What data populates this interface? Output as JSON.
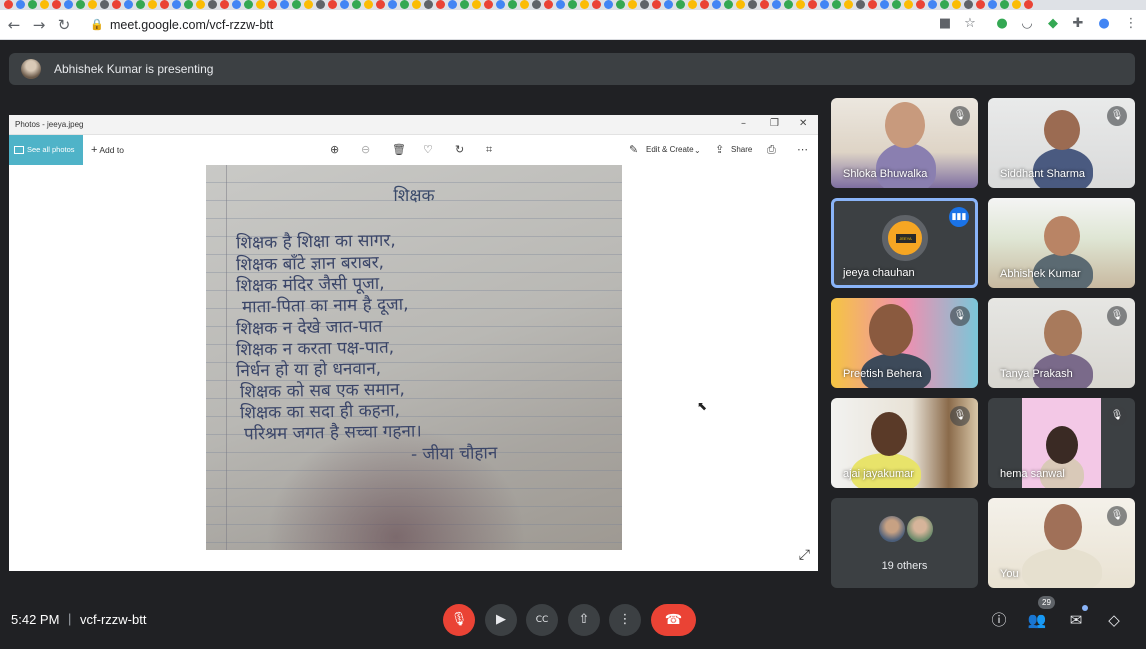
{
  "browser": {
    "url": "meet.google.com/vcf-rzzw-btt",
    "tab_colors": [
      "#ea4335",
      "#4285f4",
      "#34a853",
      "#fbbc05",
      "#ea4335",
      "#4285f4",
      "#34a853",
      "#fbbc05",
      "#5f6368",
      "#ea4335",
      "#4285f4",
      "#34a853",
      "#fbbc05",
      "#ea4335",
      "#4285f4",
      "#34a853",
      "#fbbc05",
      "#5f6368",
      "#ea4335",
      "#4285f4",
      "#34a853",
      "#fbbc05",
      "#ea4335",
      "#4285f4",
      "#34a853",
      "#fbbc05",
      "#5f6368",
      "#ea4335",
      "#4285f4",
      "#34a853",
      "#fbbc05",
      "#ea4335",
      "#4285f4",
      "#34a853",
      "#fbbc05",
      "#5f6368",
      "#ea4335",
      "#4285f4",
      "#34a853",
      "#fbbc05",
      "#ea4335",
      "#4285f4",
      "#34a853",
      "#fbbc05",
      "#5f6368",
      "#ea4335",
      "#4285f4",
      "#34a853",
      "#fbbc05",
      "#ea4335",
      "#4285f4",
      "#34a853",
      "#fbbc05",
      "#5f6368",
      "#ea4335",
      "#4285f4",
      "#34a853",
      "#fbbc05",
      "#ea4335",
      "#4285f4",
      "#34a853",
      "#fbbc05",
      "#5f6368",
      "#ea4335",
      "#4285f4",
      "#34a853",
      "#fbbc05",
      "#ea4335",
      "#4285f4",
      "#34a853",
      "#fbbc05",
      "#5f6368",
      "#ea4335",
      "#4285f4",
      "#34a853",
      "#fbbc05",
      "#ea4335",
      "#4285f4",
      "#34a853",
      "#fbbc05",
      "#5f6368",
      "#ea4335",
      "#4285f4",
      "#34a853",
      "#fbbc05",
      "#ea4335"
    ]
  },
  "banner": {
    "text": "Abhishek Kumar is presenting"
  },
  "photos_app": {
    "title": "Photos - jeeya.jpeg",
    "see_all": "See all photos",
    "add_to": "Add to",
    "edit_create": "Edit & Create",
    "share": "Share",
    "poem_title": "शिक्षक",
    "poem_lines": [
      "शिक्षक है शिक्षा का सागर,",
      "शिक्षक बाँटे ज्ञान बराबर,",
      "शिक्षक मंदिर जैसी पूजा,",
      "माता-पिता का नाम है दूजा,",
      "शिक्षक न देखे जात-पात",
      "शिक्षक न करता पक्ष-पात,",
      "निर्धन हो या हो धनवान,",
      "शिक्षक को सब एक समान,",
      "शिक्षक का सदा ही कहना,",
      "परिश्रम जगत है सच्चा गहना।",
      "- जीया चौहान"
    ]
  },
  "participants": [
    {
      "name": "Shloka Bhuwalka",
      "muted": true
    },
    {
      "name": "Siddhant Sharma",
      "muted": true
    },
    {
      "name": "jeeya chauhan",
      "speaking": true,
      "avatar_text": "JEEYA"
    },
    {
      "name": "Abhishek Kumar"
    },
    {
      "name": "Preetish Behera",
      "muted": true
    },
    {
      "name": "Tanya Prakash",
      "muted": true
    },
    {
      "name": "ajai jayakumar",
      "muted": true
    },
    {
      "name": "hema sanwal",
      "muted": true
    },
    {
      "name": "19 others"
    },
    {
      "name": "You",
      "muted": true
    }
  ],
  "bottom_bar": {
    "time": "5:42 PM",
    "separator": "|",
    "meeting_code": "vcf-rzzw-btt",
    "participant_count": "29"
  }
}
